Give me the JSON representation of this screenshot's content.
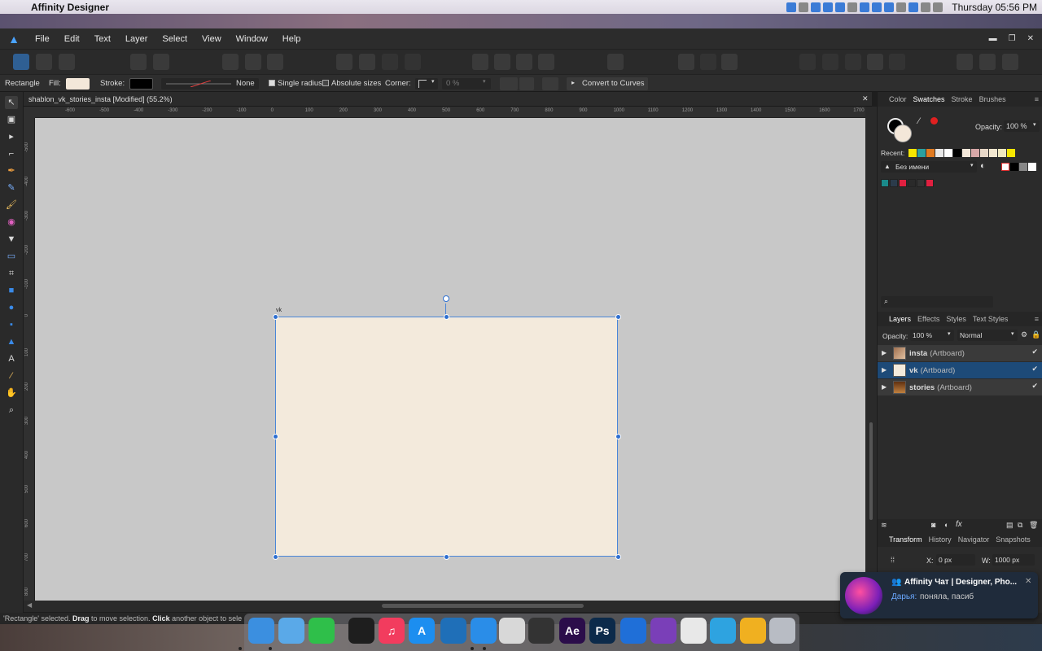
{
  "macos": {
    "app_name": "Affinity Designer",
    "clock": "Thursday 05:56 PM"
  },
  "menu": {
    "items": [
      "File",
      "Edit",
      "Text",
      "Layer",
      "Select",
      "View",
      "Window",
      "Help"
    ]
  },
  "context": {
    "tool": "Rectangle",
    "fill_label": "Fill:",
    "fill_color": "#f3e7d9",
    "stroke_label": "Stroke:",
    "stroke_color": "#000000",
    "stroke_style": "None",
    "single_radius": "Single radius",
    "absolute_sizes": "Absolute sizes",
    "corner_label": "Corner:",
    "corner_value": "0 %",
    "convert": "Convert to Curves"
  },
  "document": {
    "tab_title": "shablon_vk_stories_insta [Modified] (55.2%)",
    "artboard_label": "vk",
    "artboard_color": "#f3eadc",
    "hruler_ticks": [
      "-600",
      "-500",
      "-400",
      "-300",
      "-200",
      "-100",
      "0",
      "100",
      "200",
      "300",
      "400",
      "500",
      "600",
      "700",
      "800",
      "900",
      "1000",
      "1100",
      "1200",
      "1300",
      "1400",
      "1500",
      "1600",
      "1700"
    ],
    "vruler_ticks": [
      "-500",
      "-400",
      "-300",
      "-200",
      "-100",
      "0",
      "100",
      "200",
      "300",
      "400",
      "500",
      "600",
      "700",
      "800"
    ]
  },
  "right_panel": {
    "top_tabs": [
      "Color",
      "Swatches",
      "Stroke",
      "Brushes"
    ],
    "active_top_tab": "Swatches",
    "opacity_label": "Opacity:",
    "opacity_value": "100 %",
    "recent_label": "Recent:",
    "recent_colors": [
      "#f5e600",
      "#2aa0a0",
      "#e07a20",
      "#e8e8e8",
      "#ffffff",
      "#000000",
      "#f3e7d9",
      "#d8a8a8",
      "#e8d8c8",
      "#f3e8d0",
      "#f0e8c0",
      "#f5e600"
    ],
    "palette_name": "Без имени",
    "palette_swatches": [
      "#1a8a8a",
      "#2b3b4b",
      "#e02040",
      "#2a2a2a",
      "#333333",
      "#e02040"
    ],
    "layers_tabs": [
      "Layers",
      "Effects",
      "Styles",
      "Text Styles"
    ],
    "active_layers_tab": "Layers",
    "layers_opacity_label": "Opacity:",
    "layers_opacity": "100 %",
    "blend_mode": "Normal",
    "layers": [
      {
        "name": "insta",
        "type": "(Artboard)"
      },
      {
        "name": "vk",
        "type": "(Artboard)"
      },
      {
        "name": "stories",
        "type": "(Artboard)"
      }
    ],
    "transform_tabs": [
      "Transform",
      "History",
      "Navigator",
      "Snapshots"
    ],
    "active_transform_tab": "Transform",
    "x_label": "X:",
    "x_value": "0 px",
    "w_label": "W:",
    "w_value": "1000 px"
  },
  "status": {
    "text_a": "'Rectangle' selected. ",
    "drag": "Drag",
    "text_b": " to move selection. ",
    "click": "Click",
    "text_c": " another object to sele"
  },
  "notification": {
    "title": "Affinity Чат | Designer, Pho...",
    "sender": "Дарья:",
    "message": "поняла, пасиб"
  },
  "dock": {
    "apps": [
      {
        "name": "finder",
        "label": "",
        "color": "#3b8fe0"
      },
      {
        "name": "files",
        "label": "",
        "color": "#5aa9e8"
      },
      {
        "name": "facetime",
        "label": "",
        "color": "#2fbf4a"
      },
      {
        "name": "figma",
        "label": "",
        "color": "#1e1e1e"
      },
      {
        "name": "music",
        "label": "♫",
        "color": "#f23c5e"
      },
      {
        "name": "app-store",
        "label": "A",
        "color": "#1c8ef0"
      },
      {
        "name": "vscode",
        "label": "",
        "color": "#1f6fb8"
      },
      {
        "name": "safari",
        "label": "",
        "color": "#2a8de8"
      },
      {
        "name": "affinity-cloud",
        "label": "",
        "color": "#d8d8d8"
      },
      {
        "name": "davinci",
        "label": "",
        "color": "#333333"
      },
      {
        "name": "after-effects",
        "label": "Ae",
        "color": "#2b0d4a"
      },
      {
        "name": "photoshop",
        "label": "Ps",
        "color": "#0c2a4a"
      },
      {
        "name": "affinity-designer",
        "label": "",
        "color": "#1f6fd8"
      },
      {
        "name": "affinity-photo",
        "label": "",
        "color": "#7a3fb8"
      },
      {
        "name": "pinwheel",
        "label": "",
        "color": "#e8e8e8"
      },
      {
        "name": "telegram",
        "label": "",
        "color": "#2ea3e0"
      },
      {
        "name": "color-app",
        "label": "",
        "color": "#f0b020"
      },
      {
        "name": "trash",
        "label": "",
        "color": "#b8bcc4"
      }
    ]
  }
}
